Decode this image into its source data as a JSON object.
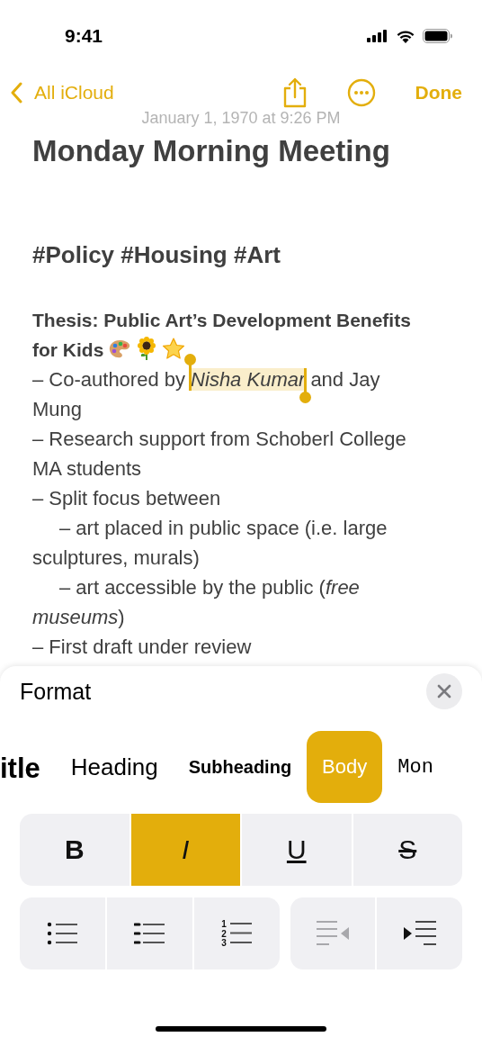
{
  "status_bar": {
    "time": "9:41"
  },
  "nav": {
    "back": "All iCloud",
    "done": "Done"
  },
  "note": {
    "date": "January 1, 1970 at 9:26 PM",
    "title": "Monday Morning Meeting",
    "tags": "#Policy #Housing #Art",
    "thesis": "Thesis: Public Art’s Development Benefits for Kids",
    "paragraphs": [
      {
        "indented": false,
        "segments": [
          {
            "kind": "plain",
            "text": "– Co-authored by "
          },
          {
            "kind": "selection",
            "text": "*Nisha Kumar*"
          },
          {
            "kind": "plain",
            "text": " and Jay Mung"
          }
        ]
      },
      {
        "indented": false,
        "segments": [
          {
            "kind": "plain",
            "text": "– Research support from Schoberl College MA students"
          }
        ]
      },
      {
        "indented": false,
        "segments": [
          {
            "kind": "plain",
            "text": "– Split focus between"
          }
        ]
      },
      {
        "indented": true,
        "segments": [
          {
            "kind": "plain",
            "text": "– art placed in public space (i.e. large sculptures, murals)"
          }
        ]
      },
      {
        "indented": true,
        "segments": [
          {
            "kind": "plain",
            "text": "– art accessible by the public (*free museums*)"
          }
        ]
      },
      {
        "indented": false,
        "segments": [
          {
            "kind": "plain",
            "text": "– First draft under review"
          }
        ]
      }
    ]
  },
  "format": {
    "title": "Format",
    "styles": [
      {
        "label": "itle",
        "kind": "title",
        "selected": false
      },
      {
        "label": "Heading",
        "kind": "heading",
        "selected": false
      },
      {
        "label": "Subheading",
        "kind": "subheading",
        "selected": false
      },
      {
        "label": "Body",
        "kind": "body",
        "selected": true
      },
      {
        "label": "Mon",
        "kind": "mono",
        "selected": false
      }
    ],
    "text_styles": [
      {
        "label": "B",
        "kind": "bold",
        "selected": false
      },
      {
        "label": "I",
        "kind": "italic",
        "selected": true
      },
      {
        "label": "U",
        "kind": "underline",
        "selected": false
      },
      {
        "label": "S",
        "kind": "strike",
        "selected": false
      }
    ],
    "list_styles": [
      {
        "kind": "bulleted"
      },
      {
        "kind": "dashed"
      },
      {
        "kind": "numbered",
        "numbers": [
          "1",
          "2",
          "3"
        ]
      }
    ],
    "indent_buttons": [
      {
        "kind": "decrease",
        "disabled": true
      },
      {
        "kind": "increase",
        "disabled": false
      }
    ]
  }
}
